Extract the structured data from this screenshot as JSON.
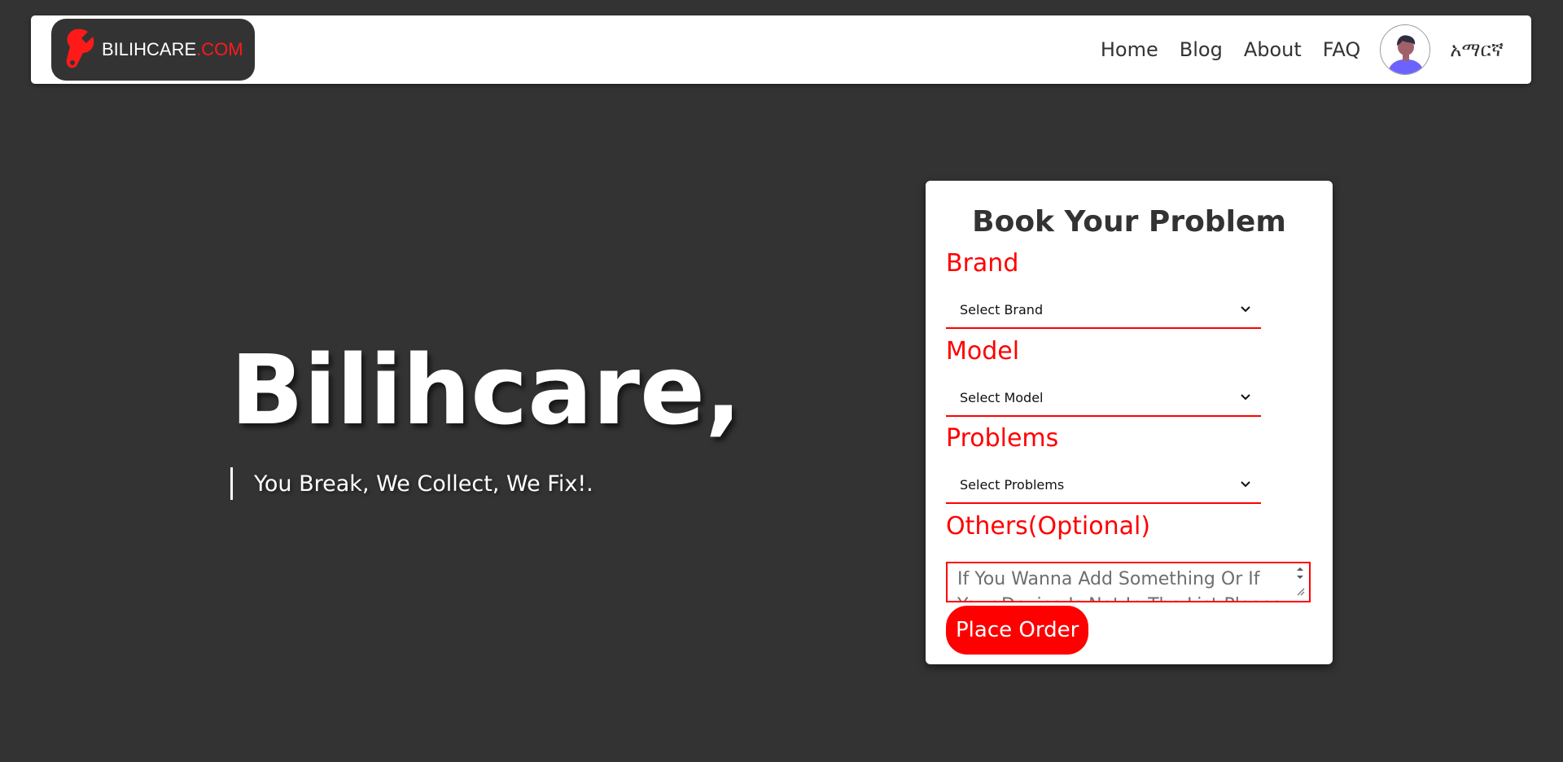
{
  "brand": {
    "logo_main": "BILIHCARE",
    "logo_accent": ".COM",
    "logo_icon": "wrench-icon"
  },
  "nav": {
    "links": [
      "Home",
      "Blog",
      "About",
      "FAQ"
    ],
    "avatar_icon": "user-avatar-icon",
    "language": "አማርኛ"
  },
  "hero": {
    "title": "Bilihcare,",
    "tagline": "You Break, We Collect, We Fix!."
  },
  "form": {
    "title": "Book Your Problem",
    "brand_label": "Brand",
    "brand_select": "Select Brand",
    "model_label": "Model",
    "model_select": "Select Model",
    "problems_label": "Problems",
    "problems_select": "Select Problems",
    "others_label": "Others(Optional)",
    "others_placeholder": "If You Wanna Add Something Or If Your Device Is Not In The List Please",
    "submit_label": "Place Order"
  },
  "colors": {
    "background": "#333333",
    "accent": "#ff0000",
    "card": "#ffffff",
    "text_dark": "#333333"
  }
}
